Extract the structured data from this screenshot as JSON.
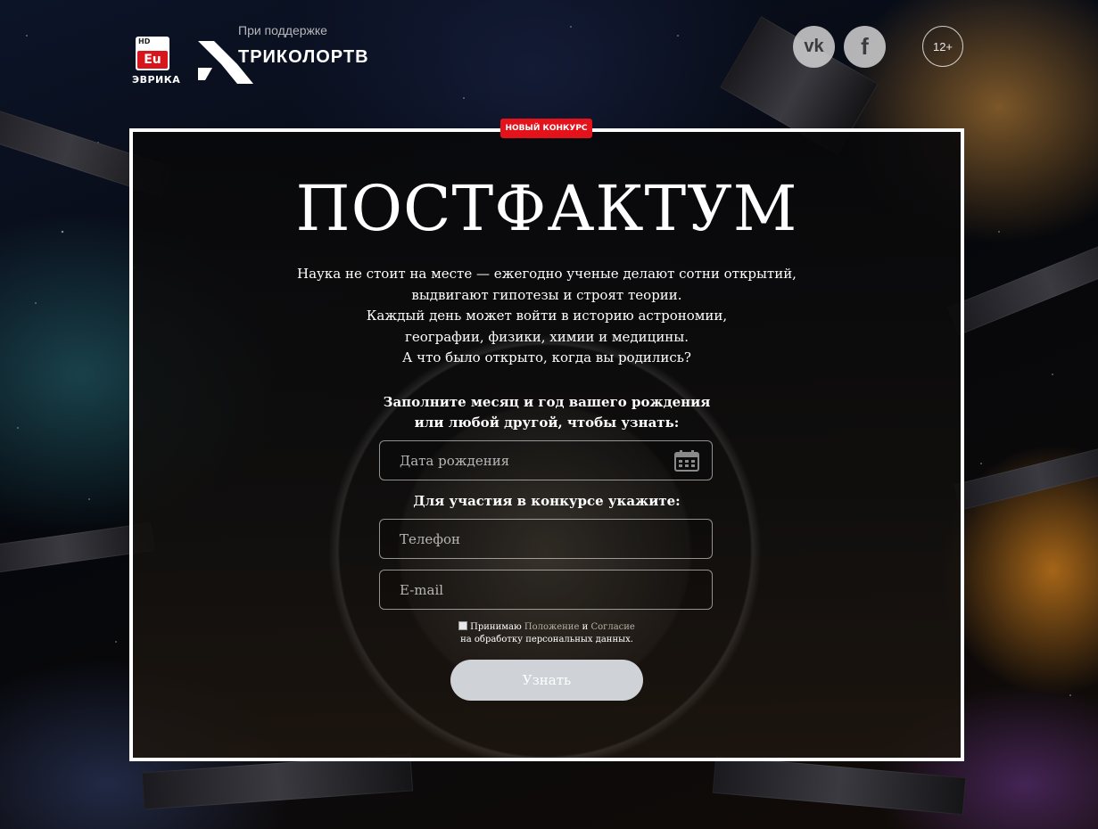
{
  "header": {
    "channel_logo": {
      "hd": "HD",
      "mark": "Eu",
      "name": "ЭВРИКА"
    },
    "sponsor": {
      "caption": "При поддержке",
      "brand": "ТРИКОЛОРТВ"
    },
    "social": [
      {
        "name": "vk",
        "label": "vk",
        "icon": "vk-icon"
      },
      {
        "name": "facebook",
        "label": "f",
        "icon": "facebook-icon"
      }
    ],
    "age_rating": "12+"
  },
  "panel": {
    "badge": "НОВЫЙ КОНКУРС",
    "title": "ПОСТФАКТУМ",
    "description": [
      "Наука не стоит на месте — ежегодно ученые делают сотни открытий,",
      "выдвигают гипотезы и строят теории.",
      "Каждый день может войти в историю астрономии,",
      "географии, физики, химии и медицины.",
      "А что было открыто, когда вы родились?"
    ],
    "date_prompt": [
      "Заполните месяц и год вашего рождения",
      "или любой другой, чтобы узнать:"
    ],
    "date_field": {
      "placeholder": "Дата рождения",
      "value": "",
      "icon": "calendar-icon"
    },
    "contest_prompt": "Для участия в конкурсе укажите:",
    "phone_field": {
      "placeholder": "Телефон",
      "value": ""
    },
    "email_field": {
      "placeholder": "E-mail",
      "value": ""
    },
    "consent": {
      "accept": "Принимаю",
      "link1": "Положение",
      "and": "и",
      "link2": "Согласие",
      "line2": "на обработку персональных данных.",
      "checked": false
    },
    "submit_label": "Узнать"
  },
  "colors": {
    "badge": "#e3121b",
    "panel_border": "#ffffff",
    "submit_bg": "#cfd2d6",
    "link": "#b9b2a2"
  }
}
